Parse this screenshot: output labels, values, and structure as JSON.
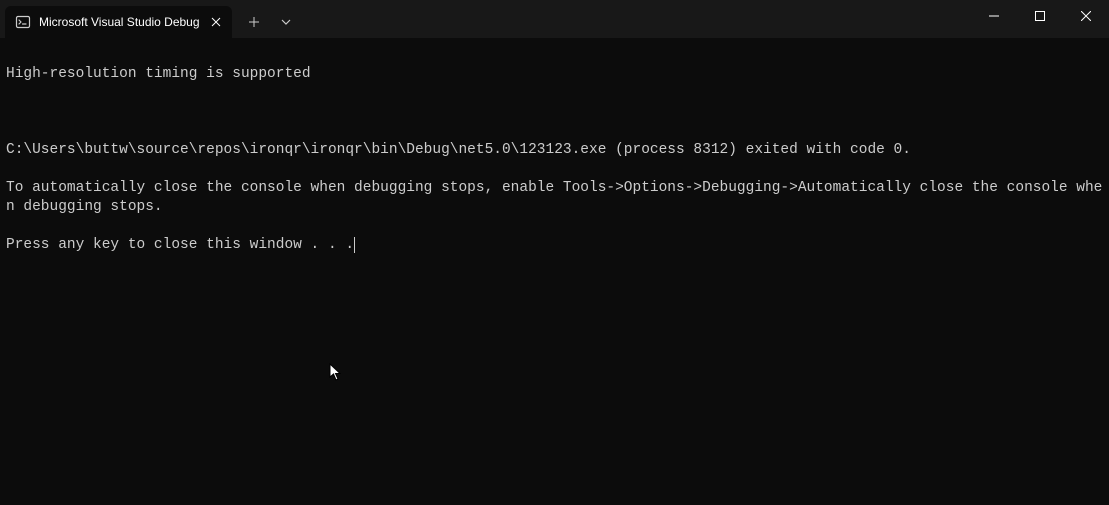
{
  "window": {
    "tab_title": "Microsoft Visual Studio Debug"
  },
  "console": {
    "line1": "High-resolution timing is supported",
    "line2": "C:\\Users\\buttw\\source\\repos\\ironqr\\ironqr\\bin\\Debug\\net5.0\\123123.exe (process 8312) exited with code 0.",
    "line3": "To automatically close the console when debugging stops, enable Tools->Options->Debugging->Automatically close the console when debugging stops.",
    "line4": "Press any key to close this window . . ."
  }
}
